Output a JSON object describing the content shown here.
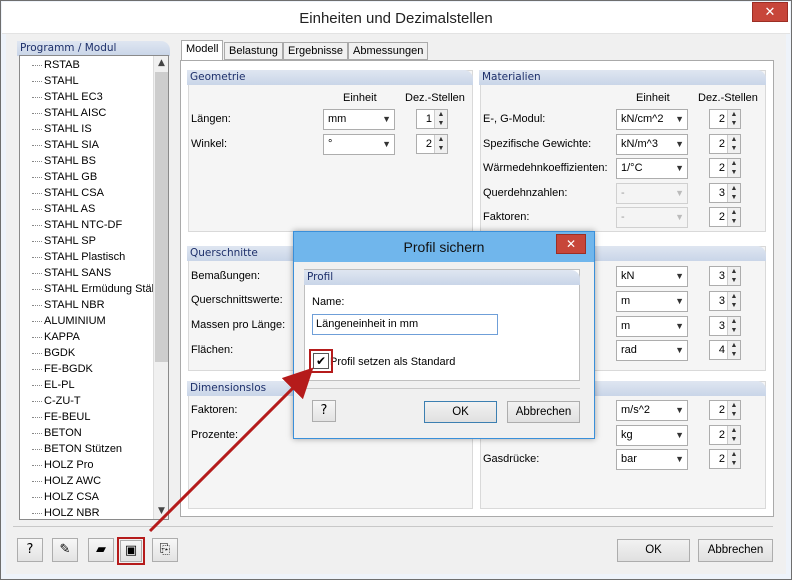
{
  "window": {
    "title": "Einheiten und Dezimalstellen",
    "close": "✕"
  },
  "left_panel": {
    "title": "Programm / Modul",
    "items": [
      "RSTAB",
      "STAHL",
      "STAHL EC3",
      "STAHL AISC",
      "STAHL IS",
      "STAHL SIA",
      "STAHL BS",
      "STAHL GB",
      "STAHL CSA",
      "STAHL AS",
      "STAHL NTC-DF",
      "STAHL SP",
      "STAHL Plastisch",
      "STAHL SANS",
      "STAHL Ermüdung Stäb",
      "STAHL NBR",
      "ALUMINIUM",
      "KAPPA",
      "BGDK",
      "FE-BGDK",
      "EL-PL",
      "C-ZU-T",
      "FE-BEUL",
      "BETON",
      "BETON Stützen",
      "HOLZ Pro",
      "HOLZ AWC",
      "HOLZ CSA",
      "HOLZ NBR"
    ]
  },
  "tabs": [
    "Modell",
    "Belastung",
    "Ergebnisse",
    "Abmessungen"
  ],
  "geometrie": {
    "title": "Geometrie",
    "col_unit": "Einheit",
    "col_dec": "Dez.-Stellen",
    "rows": [
      {
        "label": "Längen:",
        "unit": "mm",
        "dec": "1"
      },
      {
        "label": "Winkel:",
        "unit": "°",
        "dec": "2"
      }
    ]
  },
  "materialien": {
    "title": "Materialien",
    "col_unit": "Einheit",
    "col_dec": "Dez.-Stellen",
    "rows": [
      {
        "label": "E-, G-Modul:",
        "unit": "kN/cm^2",
        "dec": "2"
      },
      {
        "label": "Spezifische Gewichte:",
        "unit": "kN/m^3",
        "dec": "2"
      },
      {
        "label": "Wärmedehnkoeffizienten:",
        "unit": "1/°C",
        "dec": "2"
      },
      {
        "label": "Querdehnzahlen:",
        "unit": "-",
        "dec": "3"
      },
      {
        "label": "Faktoren:",
        "unit": "-",
        "dec": "2"
      }
    ]
  },
  "querschnitte": {
    "title": "Querschnitte",
    "rows": [
      {
        "label": "Bemaßungen:"
      },
      {
        "label": "Querschnittswerte:"
      },
      {
        "label": "Massen pro Länge:"
      },
      {
        "label": "Flächen:"
      }
    ]
  },
  "right_mid": {
    "rows": [
      {
        "unit": "kN",
        "dec": "3"
      },
      {
        "unit": "m",
        "dec": "3"
      },
      {
        "unit": "m",
        "dec": "3"
      },
      {
        "unit": "rad",
        "dec": "4"
      }
    ]
  },
  "dimensionslos": {
    "title": "Dimensionslos",
    "rows": [
      {
        "label": "Faktoren:"
      },
      {
        "label": "Prozente:"
      }
    ]
  },
  "right_bottom": {
    "rows": [
      {
        "label": "",
        "unit": "m/s^2",
        "dec": "2"
      },
      {
        "label": "",
        "unit": "kg",
        "dec": "2"
      },
      {
        "label": "Gasdrücke:",
        "unit": "bar",
        "dec": "2"
      }
    ]
  },
  "dialog": {
    "title": "Profil sichern",
    "group_title": "Profil",
    "name_label": "Name:",
    "name_value": "Längeneinheit in mm",
    "checkbox_label": "Profil setzen als Standard",
    "checkbox_checked": true,
    "ok": "OK",
    "cancel": "Abbrechen",
    "close": "✕"
  },
  "footer": {
    "ok": "OK",
    "cancel": "Abbrechen"
  },
  "icons": [
    "help-icon",
    "edit-icon",
    "open-folder-icon",
    "save-icon",
    "export-icon"
  ],
  "colors": {
    "accent_red": "#b51b1b",
    "dialog_title": "#70b6ec",
    "panel_header": "#c9d5e8"
  }
}
